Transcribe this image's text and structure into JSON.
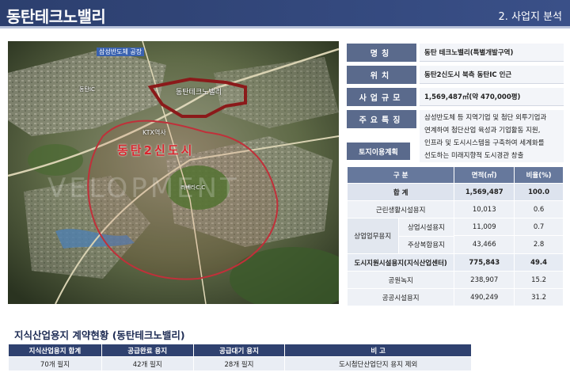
{
  "header": {
    "title": "동탄테크노밸리",
    "section": "2. 사업지 분석"
  },
  "colors": {
    "header_bg": "#2c3f6e",
    "key_bg": "#5a6a8c",
    "table_head": "#66789c",
    "boundary_red": "#8b1a1a",
    "newtown_label": "#d8262e"
  },
  "map": {
    "labels": {
      "samsung": "삼성반도체 공장",
      "techno": "동탄테크노밸리",
      "ktx": "KTX역사",
      "newtown": "동탄2신도시",
      "cc": "리베라C.C",
      "station": "동탄IC"
    },
    "watermark": "VELOPMENT"
  },
  "info": [
    {
      "key": "명칭",
      "value": "동탄 테크노밸리(특별개발구역)"
    },
    {
      "key": "위치",
      "value": "동탄2신도시 북측 동탄IC 인근"
    },
    {
      "key": "사업규모",
      "value": "1,569,487㎡(약 470,000평)"
    }
  ],
  "features": {
    "key": "주요특징",
    "lines": [
      "삼성반도체 등 지역기업 및 첨단 외투기업과",
      "연계하여 첨단산업 육성과 기업활동 지원,",
      "인프라 및 도시시스템을 구축하여 세계화를",
      "선도하는 미래지향적 도시경관 창출"
    ]
  },
  "landuse": {
    "title": "토지이용계획",
    "headers": [
      "구 분",
      "면적(㎡)",
      "비율(%)"
    ],
    "rows": {
      "total": {
        "label": "합 계",
        "area": "1,569,487",
        "ratio": "100.0"
      },
      "residential": {
        "label": "근린생활시설용지",
        "area": "10,013",
        "ratio": "0.6"
      },
      "commercial_group": "상업업무용지",
      "commercial": {
        "label": "상업시설용지",
        "area": "11,009",
        "ratio": "0.7"
      },
      "mixed": {
        "label": "주상복합용지",
        "area": "43,466",
        "ratio": "2.8"
      },
      "support": {
        "label": "도시지원시설용지(지식산업센터)",
        "area": "775,843",
        "ratio": "49.4"
      },
      "park": {
        "label": "공원녹지",
        "area": "238,907",
        "ratio": "15.2"
      },
      "public": {
        "label": "공공시설용지",
        "area": "490,249",
        "ratio": "31.2"
      }
    }
  },
  "contract": {
    "title": "지식산업용지 계약현황 (동탄테크노밸리)",
    "headers": [
      "지식산업용지 합계",
      "공급완료 용지",
      "공급대기 용지",
      "비 고"
    ],
    "values": [
      "70개 필지",
      "42개 필지",
      "28개 필지",
      "도시첨단산업단지 용지 제외"
    ]
  }
}
